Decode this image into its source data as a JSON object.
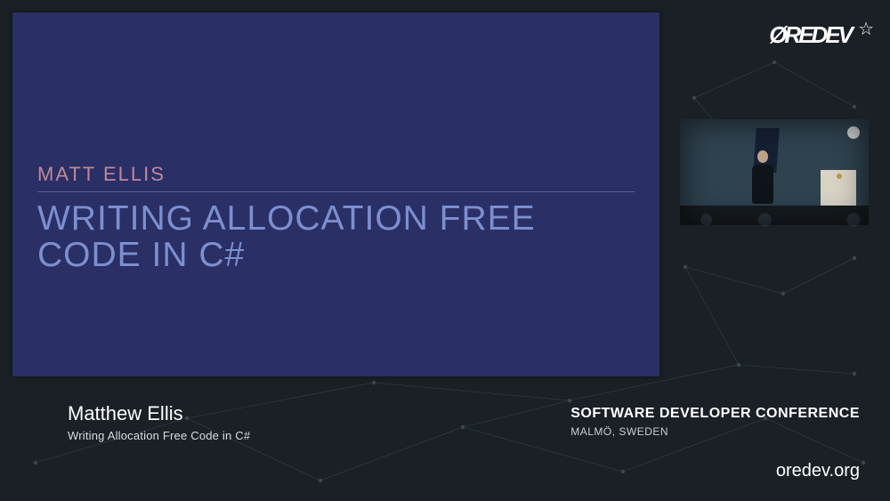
{
  "brand": {
    "logo_text": "ØREDEV",
    "star_glyph": "☆"
  },
  "slide": {
    "speaker_label": "MATT ELLIS",
    "title": "WRITING ALLOCATION FREE CODE IN C#"
  },
  "lower_third": {
    "presenter_name": "Matthew Ellis",
    "presenter_subtitle": "Writing Allocation Free Code in C#",
    "conference_name": "SOFTWARE DEVELOPER CONFERENCE",
    "location": "MALMÖ, SWEDEN"
  },
  "footer": {
    "url": "oredev.org"
  },
  "colors": {
    "bg": "#1a2026",
    "slide_bg": "#2a2f66",
    "slide_speaker": "#c0889a",
    "slide_title": "#7c8fcf",
    "text_primary": "#ffffff"
  }
}
